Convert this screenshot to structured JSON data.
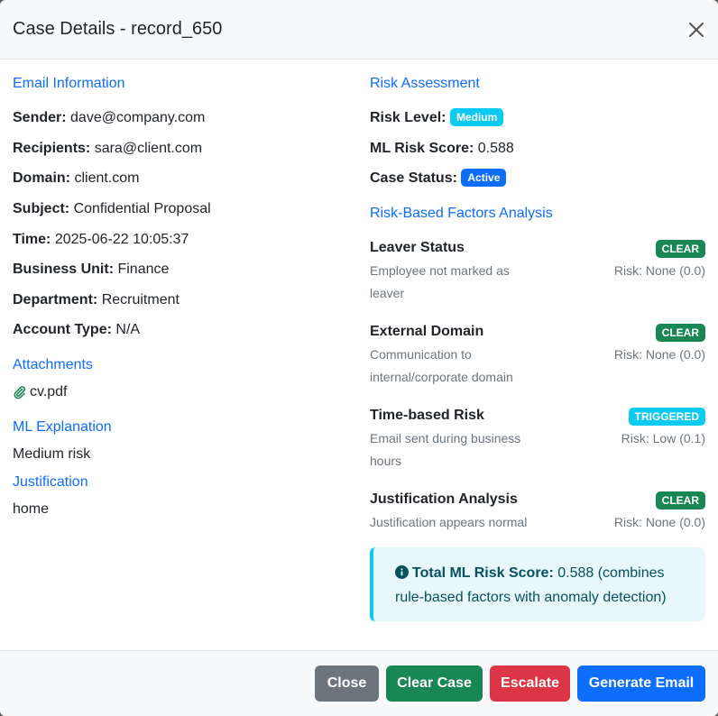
{
  "modal": {
    "title": "Case Details - record_650"
  },
  "email_info": {
    "section_title": "Email Information",
    "fields": [
      {
        "label": "Sender:",
        "value": "dave@company.com"
      },
      {
        "label": "Recipients:",
        "value": "sara@client.com"
      },
      {
        "label": "Domain:",
        "value": "client.com"
      },
      {
        "label": "Subject:",
        "value": "Confidential Proposal"
      },
      {
        "label": "Time:",
        "value": "2025-06-22 10:05:37"
      },
      {
        "label": "Business Unit:",
        "value": "Finance"
      },
      {
        "label": "Department:",
        "value": "Recruitment"
      },
      {
        "label": "Account Type:",
        "value": "N/A"
      }
    ]
  },
  "attachments": {
    "section_title": "Attachments",
    "files": [
      "cv.pdf"
    ],
    "icon": "paperclip-icon"
  },
  "ml_explanation": {
    "section_title": "ML Explanation",
    "text": "Medium risk"
  },
  "justification": {
    "section_title": "Justification",
    "text": "home"
  },
  "risk_assessment": {
    "section_title": "Risk Assessment",
    "risk_level_label": "Risk Level:",
    "risk_level_badge": "Medium",
    "ml_score_label": "ML Risk Score:",
    "ml_score_value": "0.588",
    "case_status_label": "Case Status:",
    "case_status_badge": "Active"
  },
  "factors": {
    "section_title": "Risk-Based Factors Analysis",
    "items": [
      {
        "name": "Leaver Status",
        "badge": "CLEAR",
        "badge_color": "#198754",
        "desc": "Employee not marked as leaver",
        "risk": "Risk: None (0.0)"
      },
      {
        "name": "External Domain",
        "badge": "CLEAR",
        "badge_color": "#198754",
        "desc": "Communication to internal/corporate domain",
        "risk": "Risk: None (0.0)"
      },
      {
        "name": "Time-based Risk",
        "badge": "TRIGGERED",
        "badge_color": "#0dcaf0",
        "desc": "Email sent during business hours",
        "risk": "Risk: Low (0.1)"
      },
      {
        "name": "Justification Analysis",
        "badge": "CLEAR",
        "badge_color": "#198754",
        "desc": "Justification appears normal",
        "risk": "Risk: None (0.0)"
      }
    ]
  },
  "summary": {
    "icon": "info-circle-icon",
    "label": "Total ML Risk Score:",
    "text": " 0.588 (combines rule-based factors with anomaly detection)"
  },
  "footer": {
    "close_label": "Close",
    "clear_label": "Clear Case",
    "escalate_label": "Escalate",
    "generate_label": "Generate Email"
  },
  "colors": {
    "primary": "#0d6efd",
    "success": "#198754",
    "danger": "#dc3545",
    "secondary": "#6c757d",
    "info": "#0dcaf0"
  }
}
